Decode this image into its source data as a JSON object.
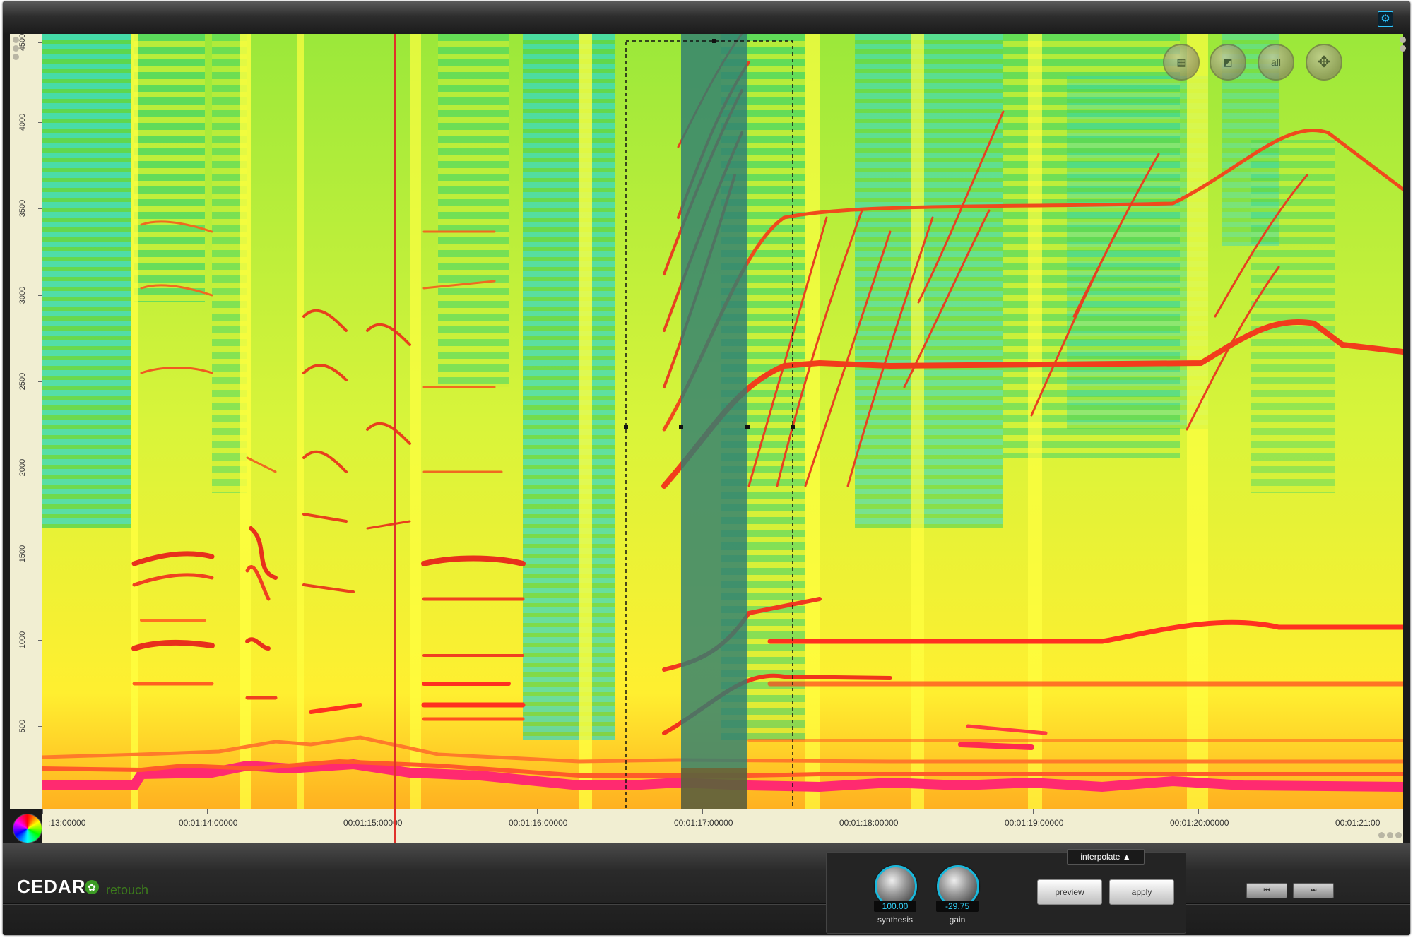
{
  "header": {
    "settings_icon": "gear-icon"
  },
  "frequency_axis": {
    "labels": [
      "4500",
      "4000",
      "3500",
      "3000",
      "2500",
      "2000",
      "1500",
      "1000",
      "500"
    ]
  },
  "time_axis": {
    "labels": [
      ":13:00000",
      "00:01:14:00000",
      "00:01:15:00000",
      "00:01:16:00000",
      "00:01:17:00000",
      "00:01:18:00000",
      "00:01:19:00000",
      "00:01:20:00000",
      "00:01:21:00"
    ]
  },
  "spectrogram_tools": {
    "items": [
      {
        "icon": "rect-select-icon",
        "label": ""
      },
      {
        "icon": "lasso-select-icon",
        "label": ""
      },
      {
        "icon": "select-all-icon",
        "label": "all"
      },
      {
        "icon": "move-icon",
        "label": ""
      }
    ]
  },
  "colors": {
    "background": "#c8f23a",
    "yellow": "#ffff30",
    "cyan": "#14e6e6",
    "green": "#4ccf4a",
    "red": "#e8301c",
    "pink": "#ff2a70",
    "playhead": "#e0302a",
    "knob_accent": "#19b8dc"
  },
  "branding": {
    "logo": "CEDAR",
    "product": "retouch"
  },
  "panel": {
    "mode_label": "interpolate",
    "mode_arrow": "▲",
    "knobs": [
      {
        "value": "100.00",
        "label": "synthesis"
      },
      {
        "value": "-29.75",
        "label": "gain"
      }
    ],
    "buttons": {
      "preview": "preview",
      "apply": "apply"
    }
  },
  "small_buttons": {
    "left": "⏮",
    "right": "⏭"
  }
}
